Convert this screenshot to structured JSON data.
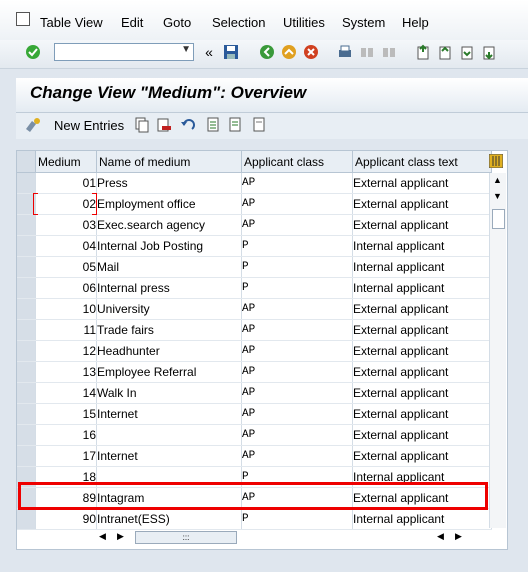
{
  "menu": {
    "items": [
      "Table View",
      "Edit",
      "Goto",
      "Selection",
      "Utilities",
      "System",
      "Help"
    ]
  },
  "toolbar": {
    "command_field_value": "",
    "icons": [
      "check-icon",
      "back-icon",
      "exit-icon",
      "cancel-icon",
      "print-icon",
      "find-icon",
      "find-next-icon",
      "first-page-icon",
      "prev-page-icon",
      "next-page-icon",
      "last-page-icon",
      "save-icon"
    ]
  },
  "title": "Change View \"Medium\": Overview",
  "app_toolbar": {
    "new_entries_label": "New Entries"
  },
  "table": {
    "columns": [
      "Medium",
      "Name of medium",
      "Applicant class",
      "Applicant class text"
    ],
    "rows": [
      {
        "medium": "01",
        "name": "Press",
        "cls": "AP",
        "text": "External applicant"
      },
      {
        "medium": "02",
        "name": "Employment office",
        "cls": "AP",
        "text": "External applicant"
      },
      {
        "medium": "03",
        "name": "Exec.search agency",
        "cls": "AP",
        "text": "External applicant"
      },
      {
        "medium": "04",
        "name": "Internal Job Posting",
        "cls": "P",
        "text": "Internal applicant"
      },
      {
        "medium": "05",
        "name": "Mail",
        "cls": "P",
        "text": "Internal applicant"
      },
      {
        "medium": "06",
        "name": "Internal press",
        "cls": "P",
        "text": "Internal applicant"
      },
      {
        "medium": "10",
        "name": "University",
        "cls": "AP",
        "text": "External applicant"
      },
      {
        "medium": "11",
        "name": "Trade fairs",
        "cls": "AP",
        "text": "External applicant"
      },
      {
        "medium": "12",
        "name": "Headhunter",
        "cls": "AP",
        "text": "External applicant"
      },
      {
        "medium": "13",
        "name": "Employee Referral",
        "cls": "AP",
        "text": "External applicant"
      },
      {
        "medium": "14",
        "name": "Walk In",
        "cls": "AP",
        "text": "External applicant"
      },
      {
        "medium": "15",
        "name": "Internet",
        "cls": "AP",
        "text": "External applicant"
      },
      {
        "medium": "16",
        "name": "",
        "cls": "AP",
        "text": "External applicant"
      },
      {
        "medium": "17",
        "name": "Internet",
        "cls": "AP",
        "text": "External applicant"
      },
      {
        "medium": "18",
        "name": "",
        "cls": "P",
        "text": "Internal applicant"
      },
      {
        "medium": "89",
        "name": "Intagram",
        "cls": "AP",
        "text": "External applicant"
      },
      {
        "medium": "90",
        "name": "Intranet(ESS)",
        "cls": "P",
        "text": "Internal applicant"
      }
    ]
  },
  "colors": {
    "highlight": "#e00000",
    "background": "#dfe6ee"
  }
}
